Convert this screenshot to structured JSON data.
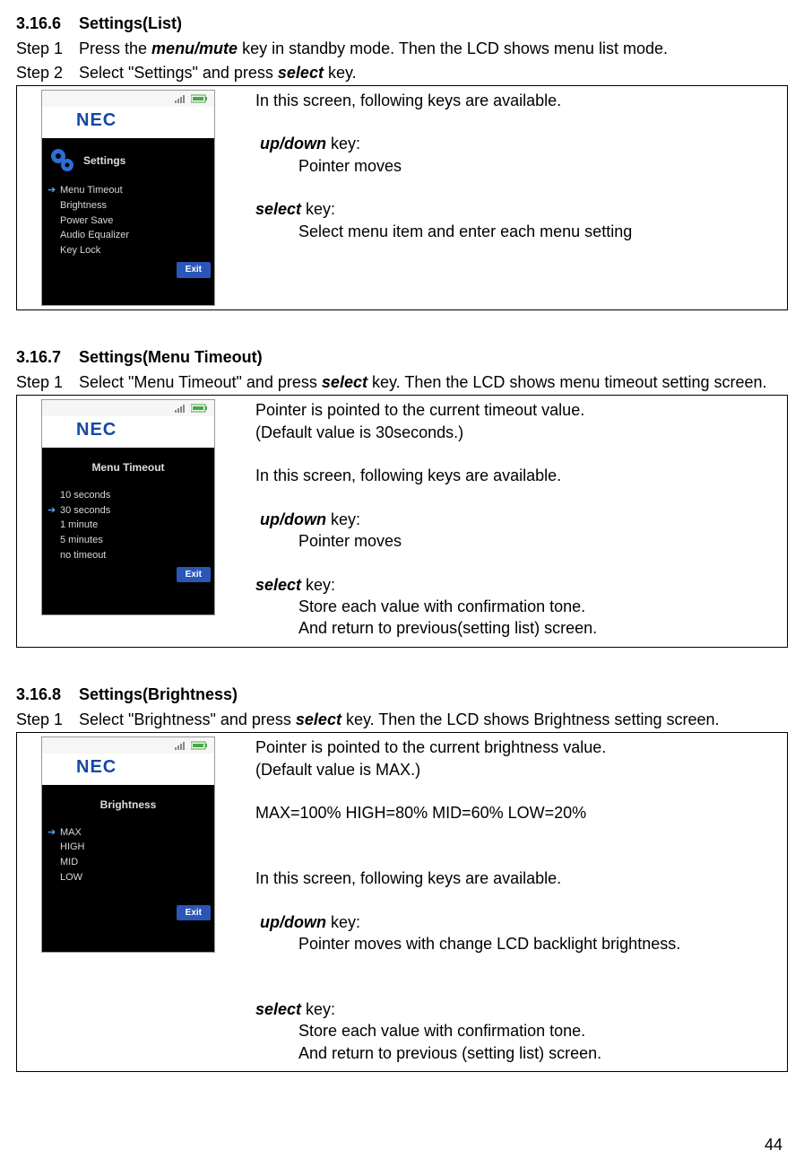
{
  "page_number": "44",
  "sec1": {
    "num": "3.16.6",
    "title": "Settings(List)",
    "step1_label": "Step 1",
    "step1_a": "Press the ",
    "step1_key": "menu/mute",
    "step1_b": " key in standby mode.  Then the LCD shows menu list mode.",
    "step2_label": "Step 2",
    "step2_a": "Select  \"Settings\" and press ",
    "step2_key": "select",
    "step2_b": " key.",
    "desc_intro": "In this screen, following keys are available.",
    "updown_label": "up/down",
    "updown_suffix": " key:",
    "updown_desc": "Pointer moves",
    "select_label": "select",
    "select_suffix": " key:",
    "select_desc": "Select menu item and enter each menu setting",
    "phone": {
      "logo": "NEC",
      "title": "Settings",
      "items": [
        "Menu Timeout",
        "Brightness",
        "Power Save",
        "Audio Equalizer",
        "Key Lock"
      ],
      "selected_index": 0,
      "exit": "Exit"
    }
  },
  "sec2": {
    "num": "3.16.7",
    "title": "Settings(Menu Timeout)",
    "step1_label": "Step 1",
    "step1_a": "Select \"Menu Timeout\" and press ",
    "step1_key": "select",
    "step1_b": " key. Then the LCD shows menu timeout setting screen.",
    "desc_p1": "Pointer is pointed to the current timeout value.",
    "desc_p2": "(Default value is 30seconds.)",
    "desc_intro": "In this screen, following keys are available.",
    "updown_label": "up/down",
    "updown_suffix": " key:",
    "updown_desc": "Pointer moves",
    "select_label": "select",
    "select_suffix": " key:",
    "select_desc1": "Store each value with confirmation tone.",
    "select_desc2": "And return to previous(setting list) screen.",
    "phone": {
      "logo": "NEC",
      "title": "Menu Timeout",
      "items": [
        "10 seconds",
        "30 seconds",
        "1 minute",
        "5 minutes",
        "no timeout"
      ],
      "selected_index": 1,
      "exit": "Exit"
    }
  },
  "sec3": {
    "num": "3.16.8",
    "title": "Settings(Brightness)",
    "step1_label": "Step 1",
    "step1_a": "Select \"Brightness\" and press ",
    "step1_key": "select",
    "step1_b": " key. Then the LCD shows Brightness setting screen.",
    "desc_p1": "Pointer is pointed to the current brightness value.",
    "desc_p2": "(Default value is MAX.)",
    "desc_vals": " MAX=100%  HIGH=80% MID=60% LOW=20%",
    "desc_intro": "In this screen, following keys are available.",
    "updown_label": "up/down",
    "updown_suffix": " key:",
    "updown_desc": "Pointer moves with change LCD backlight brightness.",
    "select_label": "select",
    "select_suffix": " key:",
    "select_desc1": "Store each value with confirmation tone.",
    "select_desc2": "And return to previous (setting list) screen.",
    "phone": {
      "logo": "NEC",
      "title": "Brightness",
      "items": [
        "MAX",
        "HIGH",
        "MID",
        "LOW"
      ],
      "selected_index": 0,
      "exit": "Exit"
    }
  }
}
